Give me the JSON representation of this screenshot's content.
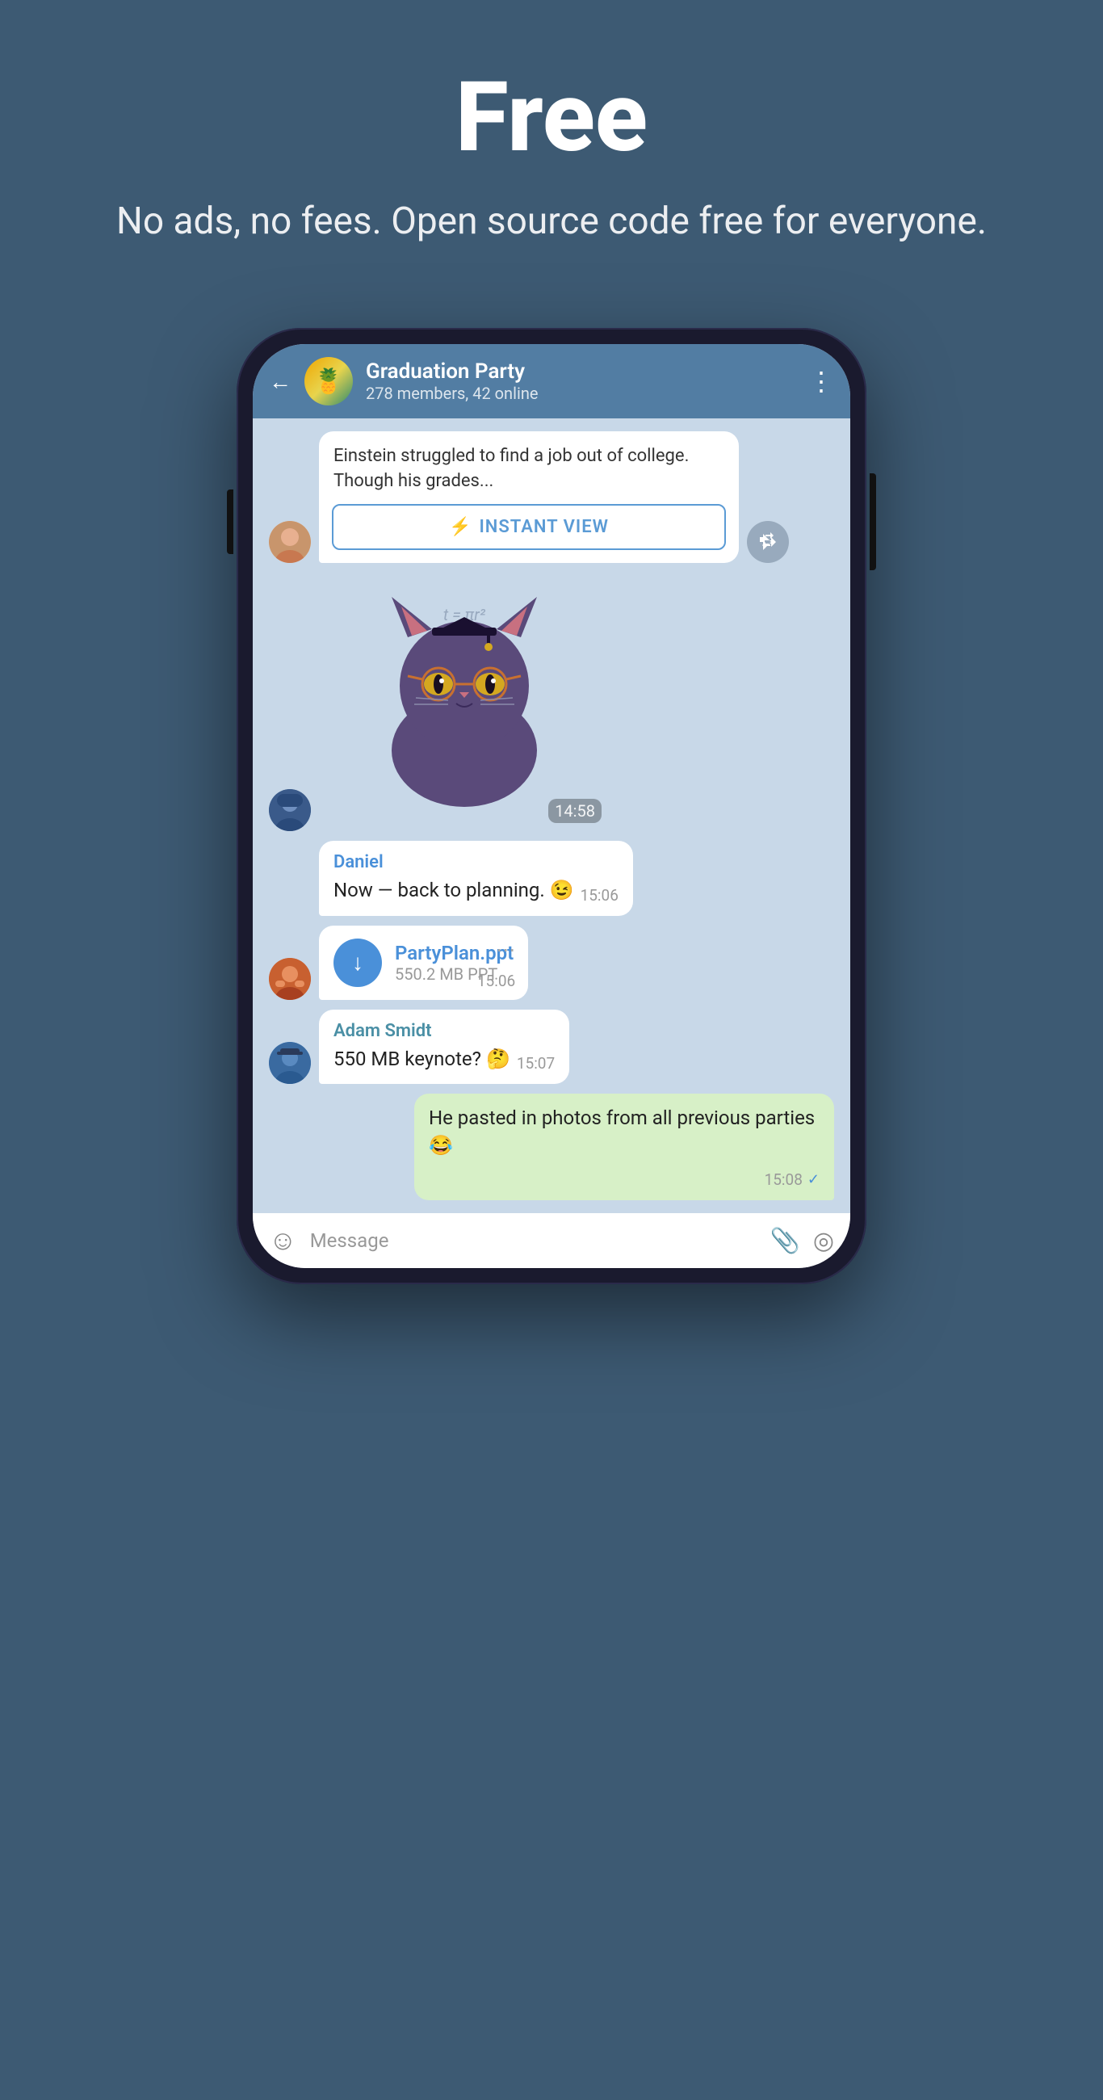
{
  "hero": {
    "title": "Free",
    "subtitle": "No ads, no fees. Open source code free for everyone."
  },
  "chat": {
    "back_label": "←",
    "group_name": "Graduation Party",
    "group_status": "278 members, 42 online",
    "menu_icon": "⋮"
  },
  "article": {
    "preview_text": "Einstein struggled to find a job out of college. Though his grades...",
    "instant_view_label": "INSTANT VIEW",
    "lightning": "⚡"
  },
  "sticker": {
    "time": "14:58"
  },
  "messages": [
    {
      "sender": "Daniel",
      "text": "Now — back to planning. 😉",
      "time": "15:06",
      "type": "incoming"
    },
    {
      "file_name": "PartyPlan.ppt",
      "file_size": "550.2 MB PPT",
      "time": "15:06",
      "type": "file"
    },
    {
      "sender": "Adam Smidt",
      "text": "550 MB keynote? 🤔",
      "time": "15:07",
      "type": "incoming"
    },
    {
      "text": "He pasted in photos from all previous parties 😂",
      "time": "15:08",
      "type": "outgoing"
    }
  ],
  "input_bar": {
    "placeholder": "Message",
    "emoji_icon": "☺",
    "attach_icon": "📎",
    "camera_icon": "◎"
  }
}
